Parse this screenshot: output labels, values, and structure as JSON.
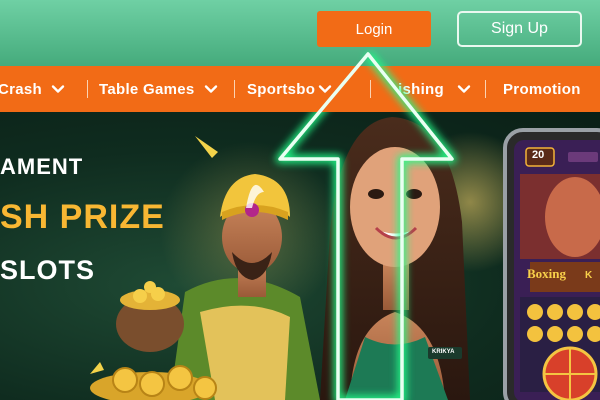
{
  "header": {
    "login_label": "Login",
    "signup_label": "Sign Up"
  },
  "nav": {
    "items": [
      {
        "label": "Crash",
        "has_dropdown": true
      },
      {
        "label": "Table Games",
        "has_dropdown": true
      },
      {
        "label": "Sportsbo",
        "has_dropdown": true
      },
      {
        "label": "ishing",
        "has_dropdown": true
      },
      {
        "label": "Promotion",
        "has_dropdown": false
      }
    ]
  },
  "banner": {
    "line1": "AMENT",
    "line2": "SH PRIZE",
    "line3": "SLOTS",
    "phone": {
      "counter": "20",
      "game_title": "Boxing",
      "game_title_suffix": "K"
    },
    "badge": "KRIKYA"
  },
  "colors": {
    "header_green": "#55b98b",
    "accent_orange": "#f26b16",
    "prize_gold": "#f8b733",
    "arrow_neon": "#39ff9a"
  }
}
